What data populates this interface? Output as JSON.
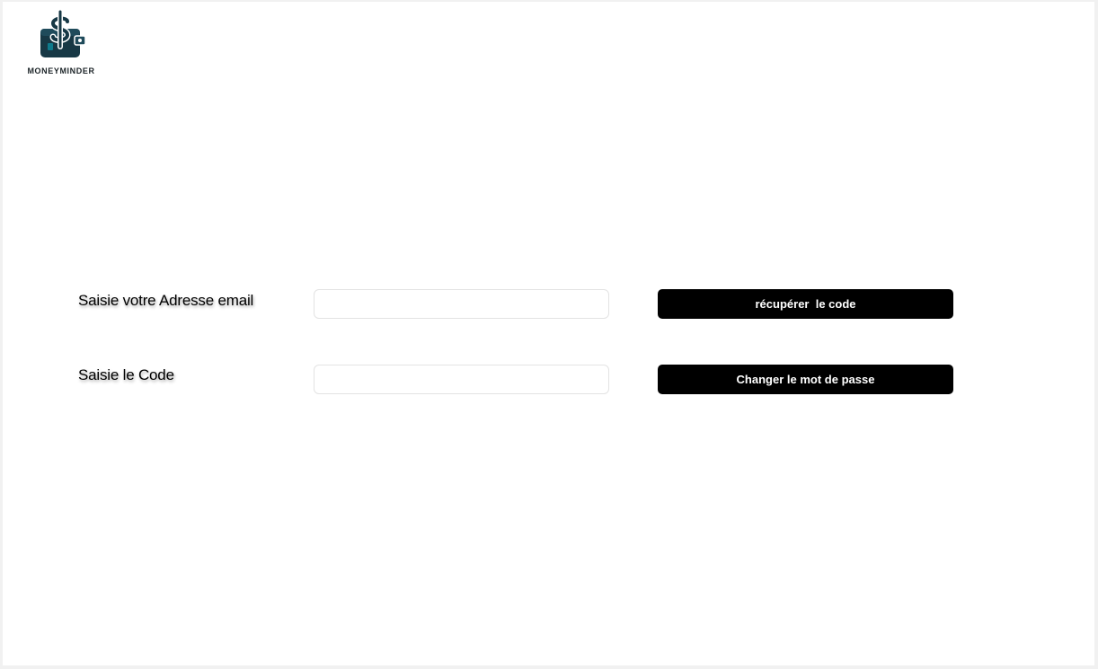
{
  "brand": {
    "name": "MONEYMINDER",
    "icon": "money-bag-dollar-icon",
    "colors": {
      "primary": "#173845",
      "accent": "#0e7a8c"
    }
  },
  "form": {
    "email_label": "Saisie votre Adresse email",
    "email_value": "",
    "code_label": "Saisie le Code",
    "code_value": "",
    "get_code_button": "récupérer  le code",
    "change_password_button": "Changer le mot de passe"
  },
  "colors": {
    "button_bg": "#000000",
    "button_text": "#ffffff",
    "input_border": "#e3e3e3"
  }
}
